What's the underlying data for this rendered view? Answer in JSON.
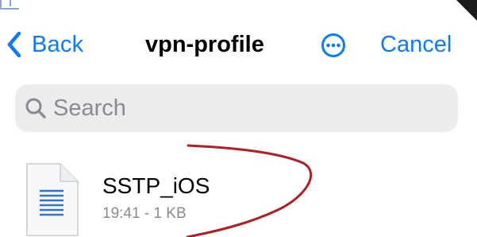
{
  "nav": {
    "back_label": "Back",
    "title": "vpn-profile",
    "more_icon": "ellipsis-circle-icon",
    "cancel_label": "Cancel"
  },
  "search": {
    "placeholder": "Search",
    "icon": "search-icon"
  },
  "files": [
    {
      "name": "SSTP_iOS",
      "meta": "19:41 - 1 KB",
      "icon": "document-icon"
    }
  ],
  "colors": {
    "accent": "#0a7aff",
    "secondary_text": "#8a8a8f",
    "search_bg": "#ececee",
    "annotation": "#b01e24"
  }
}
